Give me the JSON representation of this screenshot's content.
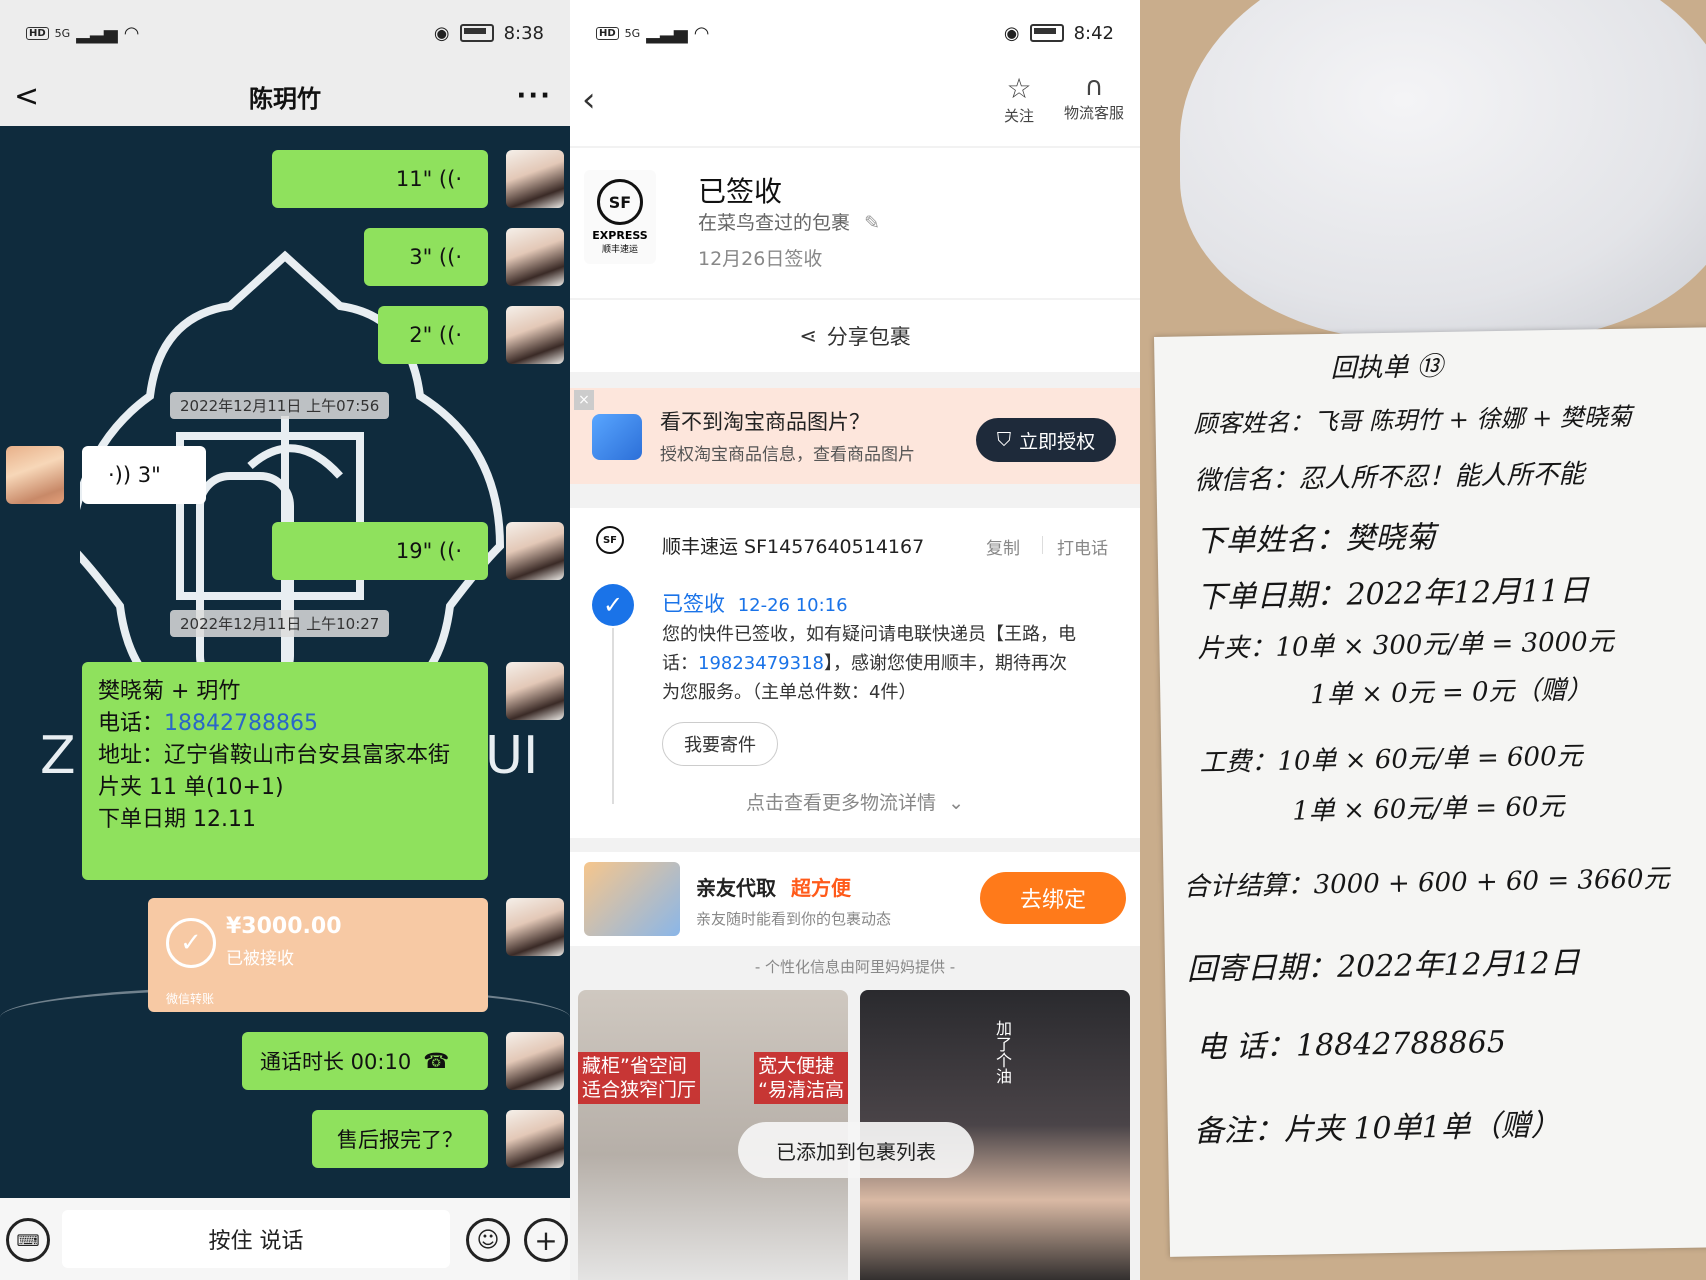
{
  "left_panel": {
    "status": {
      "time": "8:38",
      "network": "5G",
      "hd": "HD"
    },
    "header": {
      "title": "陈玥竹",
      "back": "<",
      "more": "···"
    },
    "messages": {
      "voice1": "11\" ((·",
      "voice2": "3\" ((·",
      "voice3": "2\" ((·",
      "timestamp1": "2022年12月11日 上午07:56",
      "voice_in": "·)) 3\"",
      "voice4": "19\" ((·",
      "timestamp2": "2022年12月11日 上午10:27",
      "order": {
        "line1": "樊晓菊 + 玥竹",
        "phone_label": "电话：",
        "phone": "18842788865",
        "address": "地址：辽宁省鞍山市台安县富家本街",
        "product": "片夹 11 单(10+1)",
        "date": "下单日期 12.11"
      },
      "transfer": {
        "amount": "¥3000.00",
        "status": "已被接收",
        "footer": "微信转账"
      },
      "call": "通话时长 00:10",
      "question": "售后报完了？"
    },
    "input": {
      "hold_to_talk": "按住 说话"
    },
    "bg_letters": {
      "left": "Z",
      "right": "UI"
    }
  },
  "middle_panel": {
    "status": {
      "time": "8:42",
      "network": "5G",
      "hd": "HD"
    },
    "toolbar": {
      "follow": "关注",
      "service": "物流客服"
    },
    "package": {
      "status": "已签收",
      "subtitle": "在菜鸟查过的包裹",
      "date": "12月26日签收",
      "logo_text": "EXPRESS",
      "logo_sub": "顺丰速运",
      "logo_mark": "SF"
    },
    "share": "分享包裹",
    "banner": {
      "title": "看不到淘宝商品图片？",
      "desc": "授权淘宝商品信息，查看商品图片",
      "button": "立即授权"
    },
    "tracking": {
      "carrier": "顺丰速运 SF1457640514167",
      "copy": "复制",
      "call": "打电话",
      "event_status": "已签收",
      "event_time": "12-26  10:16",
      "event_text_1": "您的快件已签收，如有疑问请电联快递员【王路，电",
      "event_text_2_prefix": "话：",
      "event_phone": "19823479318",
      "event_text_2_suffix": "】，感谢您使用顺丰，期待再次",
      "event_text_3": "为您服务。（主单总件数：4件）",
      "send_button": "我要寄件",
      "more": "点击查看更多物流详情"
    },
    "promo": {
      "title": "亲友代取",
      "highlight": "超方便",
      "desc": "亲友随时能看到你的包裹动态",
      "button": "去绑定"
    },
    "provided_by": "- 个性化信息由阿里妈妈提供 -",
    "ads": {
      "ad1_line1": "藏柜”省空间",
      "ad1_line2": "适合狭窄门厅",
      "ad1_line3": "宽大便捷",
      "ad1_line4": "“易清洁高",
      "ad2_text": "加了个油"
    },
    "toast": "已添加到包裹列表"
  },
  "right_panel": {
    "note_lines": [
      "回执单 ⑬",
      "顾客姓名：飞哥 陈玥竹 + 徐娜 + 樊晓菊",
      "微信名：忍人所不忍！能人所不能",
      "下单姓名：樊晓菊",
      "下单日期：2022年12月11日",
      "片夹：10单 × 300元/单 = 3000元",
      "1单 × 0元 = 0元（赠）",
      "工费：10单 × 60元/单 = 600元",
      "1单 × 60元/单 = 60元",
      "合计结算：3000 + 600 + 60 = 3660元",
      "回寄日期：2022年12月12日",
      "电  话：18842788865",
      "备注：片夹 10单1单（赠）"
    ]
  },
  "colors": {
    "wechat_green": "#8fe15d",
    "chat_bg": "#0f2b3d",
    "cainiao_blue": "#1a73e8",
    "orange": "#ff7a1a",
    "transfer": "#f7c9a4"
  }
}
